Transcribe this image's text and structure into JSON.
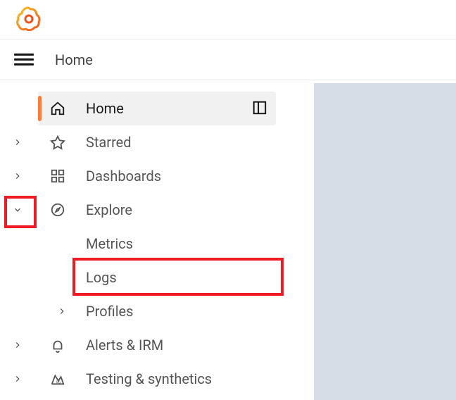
{
  "breadcrumb": {
    "title": "Home"
  },
  "sidebar": {
    "activeLabel": "Home",
    "items": {
      "starred": {
        "label": "Starred"
      },
      "dashboards": {
        "label": "Dashboards"
      },
      "explore": {
        "label": "Explore"
      },
      "alerts": {
        "label": "Alerts & IRM"
      },
      "testing": {
        "label": "Testing & synthetics"
      }
    },
    "exploreChildren": {
      "metrics": {
        "label": "Metrics"
      },
      "logs": {
        "label": "Logs"
      },
      "profiles": {
        "label": "Profiles"
      }
    }
  }
}
